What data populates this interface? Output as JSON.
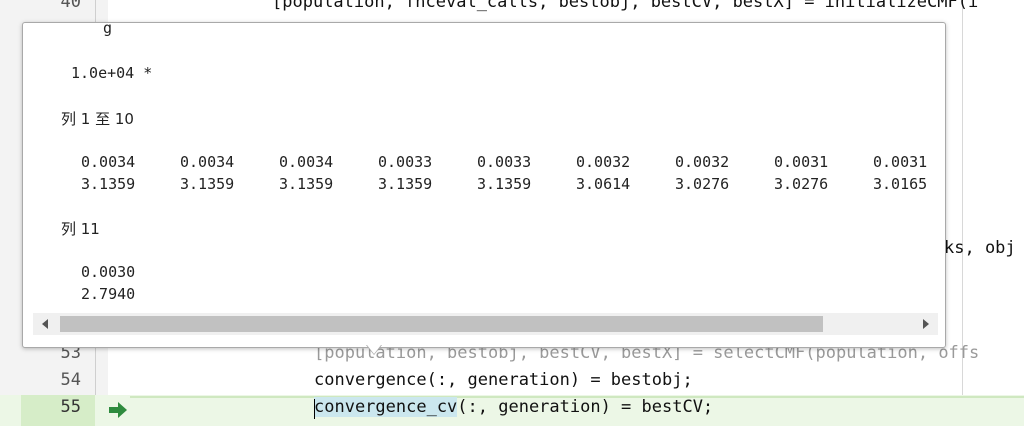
{
  "editor": {
    "lines": [
      {
        "num": "40",
        "text": "[population, fhceval_calls, bestobj, bestCV, bestX] = initializeCMF(i",
        "faded": false
      },
      {
        "num": "",
        "text": "ks, obj",
        "faded": false
      },
      {
        "num": "53",
        "text": "[population, bestobj, bestCV, bestX] = selectCMF(population, offs",
        "faded": true
      },
      {
        "num": "54",
        "text": "convergence(:, generation) = bestobj;",
        "faded": false
      },
      {
        "num": "55",
        "text_highlight": "convergence_cv",
        "text_rest": "(:, generation) = bestCV;",
        "faded": false
      }
    ],
    "current_line_icon": "green-arrow-icon"
  },
  "popup": {
    "truncated_top": "g",
    "scale_factor": "1.0e+04 *",
    "block1_header": "列 1 至 10",
    "block1_row1": [
      "0.0034",
      "0.0034",
      "0.0034",
      "0.0033",
      "0.0033",
      "0.0032",
      "0.0032",
      "0.0031",
      "0.0031"
    ],
    "block1_row2": [
      "3.1359",
      "3.1359",
      "3.1359",
      "3.1359",
      "3.1359",
      "3.0614",
      "3.0276",
      "3.0276",
      "3.0165"
    ],
    "block2_header": "列 11",
    "block2_row1": [
      "0.0030"
    ],
    "block2_row2": [
      "2.7940"
    ]
  },
  "scrollbar": {
    "left_arrow_icon": "triangle-left-icon",
    "right_arrow_icon": "triangle-right-icon"
  }
}
